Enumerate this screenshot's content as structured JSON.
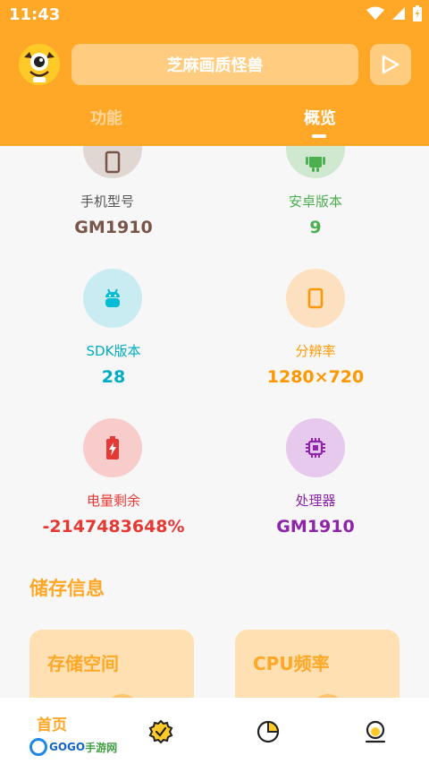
{
  "status_bar": {
    "time": "11:43"
  },
  "header": {
    "app_title": "芝麻画质怪兽",
    "tabs": [
      {
        "label": "功能",
        "active": false
      },
      {
        "label": "概览",
        "active": true
      }
    ]
  },
  "device_info": [
    {
      "label": "手机型号",
      "value": "GM1910",
      "icon": "phone-icon",
      "color": "#795548",
      "bg": "#e0d6d2"
    },
    {
      "label": "安卓版本",
      "value": "9",
      "icon": "android-icon",
      "color": "#4caf50",
      "bg": "#cfe8cf"
    },
    {
      "label": "SDK版本",
      "value": "28",
      "icon": "android-robot-icon",
      "color": "#00bcd4",
      "bg": "#c9ecf2"
    },
    {
      "label": "分辨率",
      "value": "1280×720",
      "icon": "screen-icon",
      "color": "#ff9800",
      "bg": "#fde0c0"
    },
    {
      "label": "电量剩余",
      "value": "-2147483648%",
      "icon": "battery-icon",
      "color": "#e53935",
      "bg": "#f9cccc"
    },
    {
      "label": "处理器",
      "value": "GM1910",
      "icon": "chip-icon",
      "color": "#8e24aa",
      "bg": "#e6c9ec"
    }
  ],
  "storage_section": {
    "title": "储存信息",
    "cards": [
      {
        "title": "存储空间"
      },
      {
        "title": "CPU频率"
      }
    ]
  },
  "bottom_nav": {
    "home_label": "首页",
    "icons": [
      "check-badge-icon",
      "pie-chart-icon",
      "profile-icon"
    ]
  },
  "watermark": {
    "text_a": "GOGO",
    "text_b": "手游网"
  },
  "colors": {
    "accent": "#ffa726",
    "pill": "#ffcc80",
    "card": "#ffe0b2"
  }
}
